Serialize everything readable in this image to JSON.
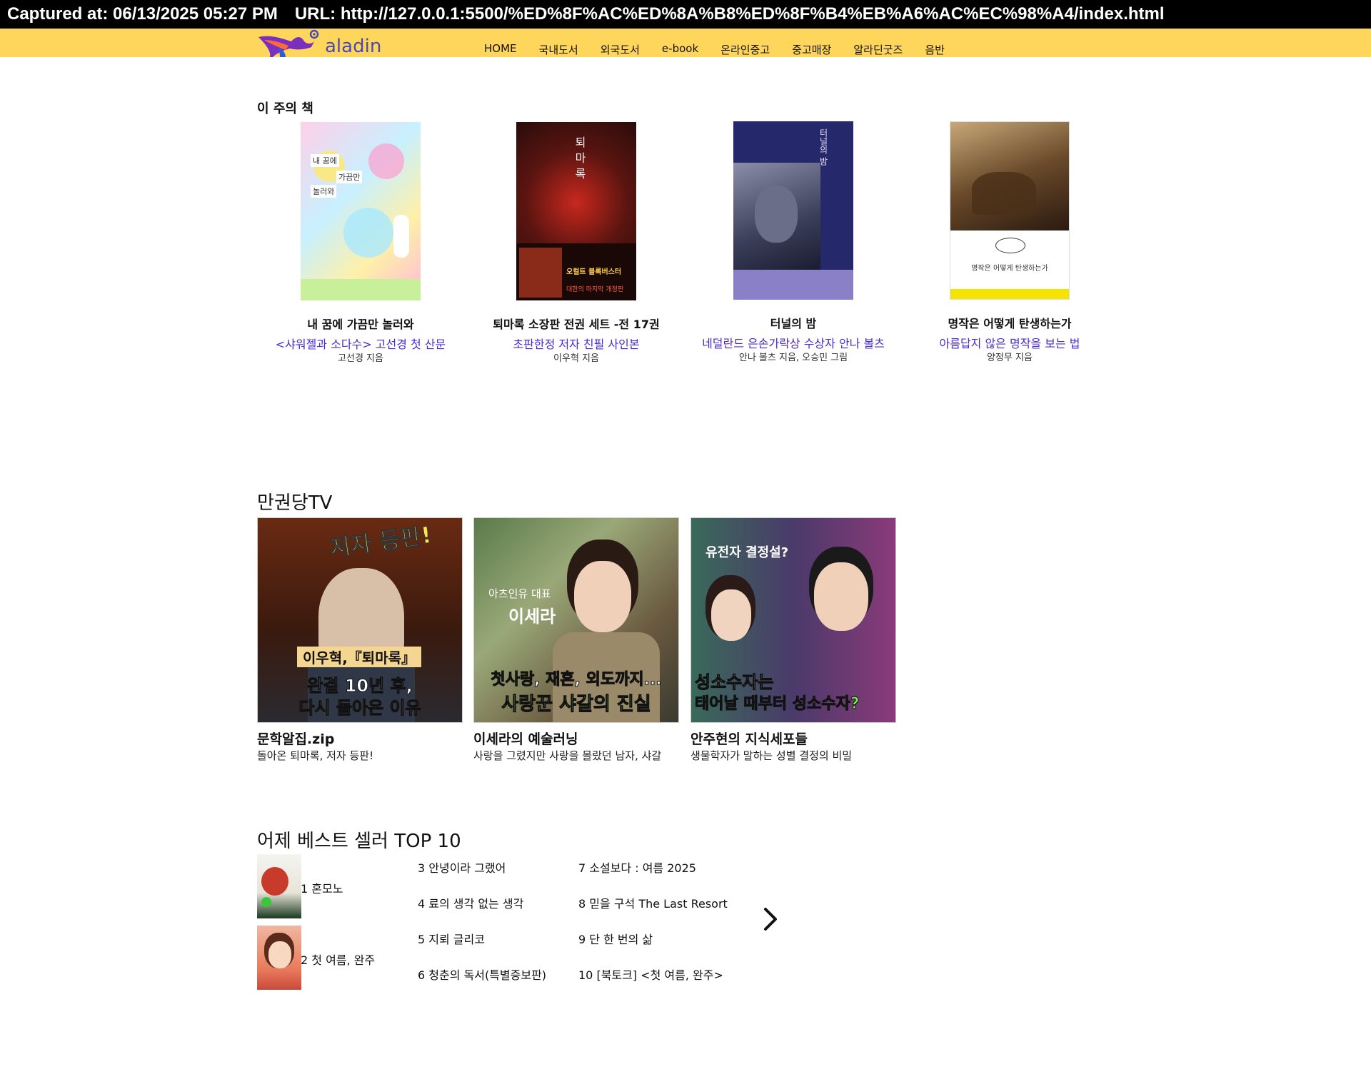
{
  "capture": {
    "captured_at": "Captured at: 06/13/2025 05:27 PM",
    "url": "URL: http://127.0.0.1:5500/%ED%8F%AC%ED%8A%B8%ED%8F%B4%EB%A6%AC%EC%98%A4/index.html"
  },
  "header": {
    "logo_text": "aladin",
    "nav": [
      "HOME",
      "국내도서",
      "외국도서",
      "e-book",
      "온라인중고",
      "중고매장",
      "알라딘굿즈",
      "음반"
    ],
    "bg_color": "#ffd65c"
  },
  "weekly": {
    "title": "이 주의 책",
    "books": [
      {
        "name": "내 꿈에 가끔만 놀러와",
        "promo": "<샤워젤과 소다수> 고선경 첫 산문",
        "author": "고선경 지음",
        "cover_text": [
          "내 꿈에",
          "가끔만",
          "놀러와"
        ]
      },
      {
        "name": "퇴마록 소장판 전권 세트 -전 17권",
        "promo": "초판한정 저자 친필 사인본",
        "author": "이우혁 지음",
        "cover_text": [
          "퇴마록",
          "오컬트 블록버스터",
          "대한의 마지막 개정판"
        ]
      },
      {
        "name": "터널의 밤",
        "promo": "네덜란드 은손가락상 수상자 안나 볼츠",
        "author": "안나 볼츠 지음, 오승민 그림",
        "cover_text": [
          "터널의 밤"
        ]
      },
      {
        "name": "명작은 어떻게 탄생하는가",
        "promo": "아름답지 않은 명작을 보는 법",
        "author": "양정무 지음",
        "cover_text": [
          "명작은 어떻게 탄생하는가"
        ]
      }
    ]
  },
  "tv": {
    "title": "만권당TV",
    "videos": [
      {
        "title": "문학알집.zip",
        "subtitle": "돌아온 퇴마록, 저자 등판!",
        "overlay": [
          "저자 등판!",
          "이우혁,『퇴마록』",
          "완결 10년 후,",
          "다시 돌아온 이유"
        ]
      },
      {
        "title": "이세라의 예술러닝",
        "subtitle": "사랑을 그렸지만 사랑을 몰랐던 남자, 샤갈",
        "overlay": [
          "아츠인유 대표",
          "이세라",
          "첫사랑, 재혼, 외도까지...",
          "사랑꾼 샤갈의 진실"
        ]
      },
      {
        "title": "안주현의 지식세포들",
        "subtitle": "생물학자가 말하는 성별 결정의 비밀",
        "overlay": [
          "유전자 결정설?",
          "성소수자는",
          "태어날 때부터 성소수자?"
        ]
      }
    ]
  },
  "bestseller": {
    "title": "어제 베스트 셀러 TOP 10",
    "items": [
      "1 혼모노",
      "2 첫 여름, 완주",
      "3 안녕이라 그랬어",
      "4 료의 생각 없는 생각",
      "5 지뢰 글리코",
      "6 청춘의 독서(특별증보판)",
      "7 소설보다 : 여름 2025",
      "8 믿을 구석 The Last Resort",
      "9 단 한 번의 삶",
      "10 [북토크] <첫 여름, 완주>"
    ],
    "next_icon": "chevron-right-icon"
  }
}
